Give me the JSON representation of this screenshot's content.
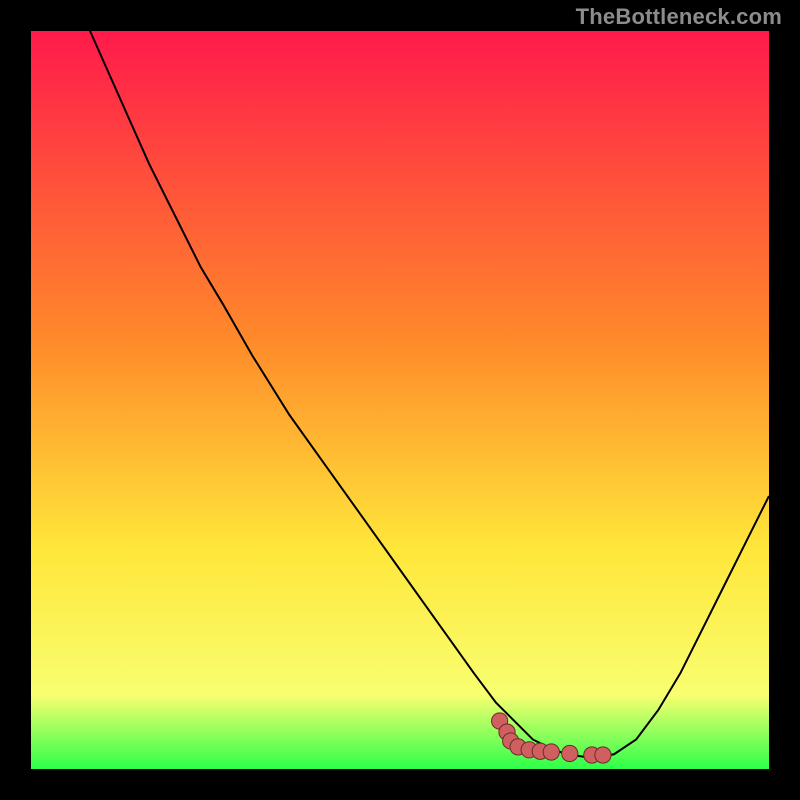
{
  "watermark": {
    "text": "TheBottleneck.com"
  },
  "colors": {
    "frame_bg": "#000000",
    "curve": "#000000",
    "marker_fill": "#d06060",
    "marker_stroke": "#6b2a2a",
    "grad_top": "#ff1a4b",
    "grad_mid1": "#ff8a2a",
    "grad_mid2": "#ffe63a",
    "grad_mid3": "#f8ff70",
    "grad_bot": "#2dff4a"
  },
  "chart_data": {
    "type": "line",
    "title": "",
    "xlabel": "",
    "ylabel": "",
    "xlim": [
      0,
      100
    ],
    "ylim": [
      0,
      100
    ],
    "grid": false,
    "legend": false,
    "series": [
      {
        "name": "curve",
        "x": [
          8,
          12,
          16,
          20,
          23,
          26,
          30,
          35,
          40,
          45,
          50,
          55,
          60,
          63,
          66,
          68,
          70,
          72,
          74,
          76,
          79,
          82,
          85,
          88,
          91,
          94,
          97,
          100
        ],
        "y": [
          100,
          91,
          82,
          74,
          68,
          63,
          56,
          48,
          41,
          34,
          27,
          20,
          13,
          9,
          6,
          4,
          3,
          2.2,
          1.8,
          1.5,
          2,
          4,
          8,
          13,
          19,
          25,
          31,
          37
        ]
      }
    ],
    "markers": {
      "name": "highlight",
      "note": "discrete marker points near the curve minimum",
      "points": [
        {
          "x": 63.5,
          "y": 6.5
        },
        {
          "x": 64.5,
          "y": 5.0
        },
        {
          "x": 65.0,
          "y": 3.8
        },
        {
          "x": 66.0,
          "y": 3.0
        },
        {
          "x": 67.5,
          "y": 2.6
        },
        {
          "x": 69.0,
          "y": 2.4
        },
        {
          "x": 70.5,
          "y": 2.3
        },
        {
          "x": 73.0,
          "y": 2.1
        },
        {
          "x": 76.0,
          "y": 1.9
        },
        {
          "x": 77.5,
          "y": 1.9
        }
      ]
    }
  }
}
